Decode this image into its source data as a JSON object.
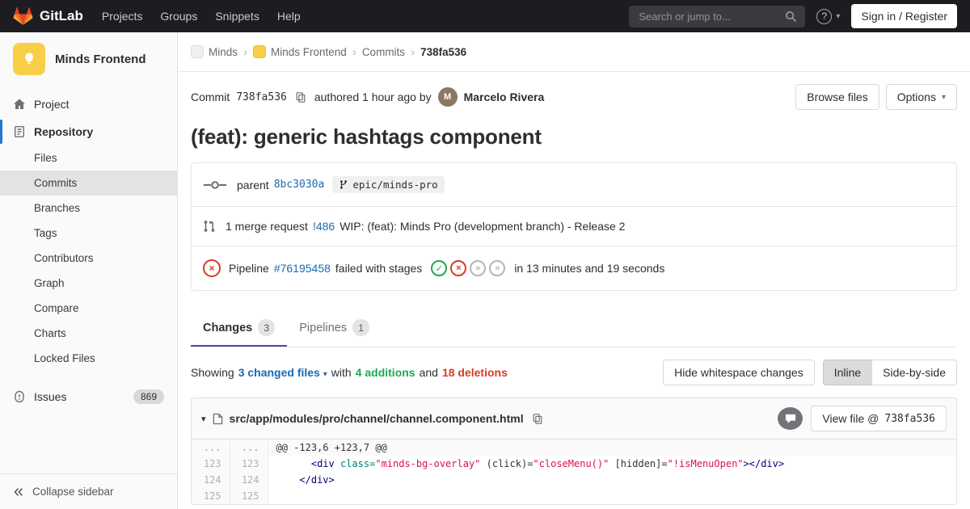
{
  "colors": {
    "brand_orange": "#fc6d26",
    "navbar_bg": "#1d1c21",
    "link_blue": "#1b69b6",
    "success_green": "#1aaa55",
    "danger_red": "#db3b21",
    "tab_active_indigo": "#4b4ba3",
    "sidebar_active_accent": "#1f78d1"
  },
  "icons": {
    "help": "?",
    "caret_down": "▾",
    "breadcrumb_separator": "›",
    "stage_success_glyph": "✓",
    "stage_failed_glyph": "×",
    "stage_skipped_glyph": "»",
    "match_line_marker": "..."
  },
  "navbar": {
    "logo_text": "GitLab",
    "menu_items": [
      {
        "label": "Projects"
      },
      {
        "label": "Groups"
      },
      {
        "label": "Snippets"
      },
      {
        "label": "Help"
      }
    ],
    "search": {
      "placeholder": "Search or jump to..."
    },
    "sign_in_label": "Sign in / Register"
  },
  "sidebar": {
    "project_name": "Minds Frontend",
    "project_avatar_color": "#f9cf48",
    "items": [
      {
        "label": "Project",
        "icon": "home-icon",
        "type": "top"
      },
      {
        "label": "Repository",
        "icon": "repository-icon",
        "type": "top",
        "active": true
      },
      {
        "label": "Files",
        "type": "sub"
      },
      {
        "label": "Commits",
        "type": "sub",
        "selected": true
      },
      {
        "label": "Branches",
        "type": "sub"
      },
      {
        "label": "Tags",
        "type": "sub"
      },
      {
        "label": "Contributors",
        "type": "sub"
      },
      {
        "label": "Graph",
        "type": "sub"
      },
      {
        "label": "Compare",
        "type": "sub"
      },
      {
        "label": "Charts",
        "type": "sub"
      },
      {
        "label": "Locked Files",
        "type": "sub"
      },
      {
        "label": "Issues",
        "icon": "issues-icon",
        "type": "top",
        "count": "869",
        "gap": true
      }
    ],
    "collapse_label": "Collapse sidebar"
  },
  "breadcrumb": {
    "items": [
      {
        "label": "Minds",
        "avatar_color": "#efefef"
      },
      {
        "label": "Minds Frontend",
        "avatar_color": "#f9cf48"
      },
      {
        "label": "Commits"
      }
    ],
    "current": "738fa536"
  },
  "commit_header": {
    "commit_label": "Commit",
    "sha": "738fa536",
    "authored_text": "authored 1 hour ago by",
    "author_name": "Marcelo Rivera",
    "author_initial": "M",
    "author_avatar_color": "#8d7762",
    "browse_files_label": "Browse files",
    "options_label": "Options"
  },
  "commit_title": "(feat): generic hashtags component",
  "commit_meta": {
    "parent_label": "parent",
    "parent_sha": "8bc3030a",
    "branch_badge": "epic/minds-pro",
    "merge_request_text": "1 merge request",
    "merge_request_ref": "!486",
    "merge_request_title": "WIP: (feat): Minds Pro (development branch) - Release 2",
    "pipeline_label": "Pipeline",
    "pipeline_id": "#76195458",
    "pipeline_status_text": "failed with stages",
    "pipeline_stages": [
      "success",
      "failed",
      "skipped",
      "skipped"
    ],
    "pipeline_duration_text": "in 13 minutes and 19 seconds"
  },
  "tabs": [
    {
      "label": "Changes",
      "count": "3",
      "active": true
    },
    {
      "label": "Pipelines",
      "count": "1",
      "active": false
    }
  ],
  "diff_toolbar": {
    "showing_label": "Showing",
    "changed_files_label": "3 changed files",
    "with_label": "with",
    "additions_label": "4 additions",
    "and_label": "and",
    "deletions_label": "18 deletions",
    "hide_whitespace_label": "Hide whitespace changes",
    "inline_label": "Inline",
    "side_by_side_label": "Side-by-side"
  },
  "file_diff": {
    "path": "src/app/modules/pro/channel/channel.component.html",
    "view_file_prefix": "View file @",
    "view_file_sha": "738fa536",
    "lines": [
      {
        "old_line": "...",
        "new_line": "...",
        "kind": "match",
        "segments": [
          {
            "text": "@@ -123,6 +123,7 @@",
            "cls": "plain"
          }
        ]
      },
      {
        "old_line": "123",
        "new_line": "123",
        "kind": "context",
        "segments": [
          {
            "text": "      ",
            "cls": "plain"
          },
          {
            "text": "<div ",
            "cls": "tag"
          },
          {
            "text": "class=",
            "cls": "attr"
          },
          {
            "text": "\"minds-bg-overlay\"",
            "cls": "str"
          },
          {
            "text": " (click)=",
            "cls": "plain"
          },
          {
            "text": "\"closeMenu()\"",
            "cls": "str"
          },
          {
            "text": " [hidden]=",
            "cls": "plain"
          },
          {
            "text": "\"!isMenuOpen\"",
            "cls": "str"
          },
          {
            "text": "></div>",
            "cls": "tag"
          }
        ]
      },
      {
        "old_line": "124",
        "new_line": "124",
        "kind": "context",
        "segments": [
          {
            "text": "    ",
            "cls": "plain"
          },
          {
            "text": "</div>",
            "cls": "tag"
          }
        ]
      },
      {
        "old_line": "125",
        "new_line": "125",
        "kind": "context",
        "segments": []
      }
    ]
  }
}
